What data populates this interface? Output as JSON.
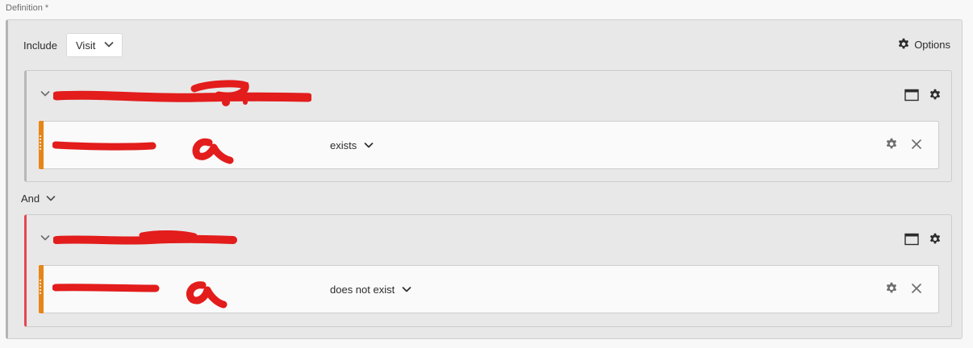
{
  "definition": {
    "label": "Definition",
    "required_mark": "*"
  },
  "header": {
    "include_label": "Include",
    "scope_dropdown": {
      "selected": "Visit"
    },
    "options_label": "Options"
  },
  "containers": [
    {
      "rule": {
        "operator": "exists"
      },
      "border_color": "#b8b8b8"
    },
    {
      "rule": {
        "operator": "does not exist"
      },
      "border_color": "#e34850"
    }
  ],
  "logic": {
    "operator": "And"
  },
  "icons": {
    "collapse": "chevron-down-icon",
    "container_view": "window-icon",
    "settings": "gear-icon",
    "remove": "close-icon",
    "drag": "drag-handle-icon"
  },
  "colors": {
    "handle_accent": "#e68619",
    "exclude_accent": "#e34850",
    "redaction": "#e31c1c"
  }
}
